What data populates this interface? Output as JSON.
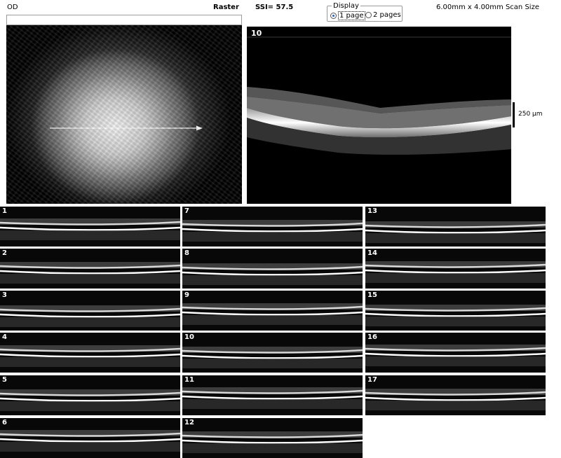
{
  "header": {
    "eye": "OD",
    "mode": "Raster",
    "ssi": "SSI= 57.5",
    "scan_size": "6.00mm x 4.00mm Scan Size"
  },
  "display": {
    "legend": "Display",
    "options": [
      {
        "label": "1 page",
        "selected": true
      },
      {
        "label": "2 pages",
        "selected": false
      }
    ]
  },
  "main_scan": {
    "number": "10",
    "scale_label": "250 µm"
  },
  "thumbnails": [
    "1",
    "2",
    "3",
    "4",
    "5",
    "6",
    "7",
    "8",
    "9",
    "10",
    "11",
    "12",
    "13",
    "14",
    "15",
    "16",
    "17"
  ],
  "colors": {
    "radio_accent": "#2a5bd7",
    "scan_background": "#000000"
  }
}
